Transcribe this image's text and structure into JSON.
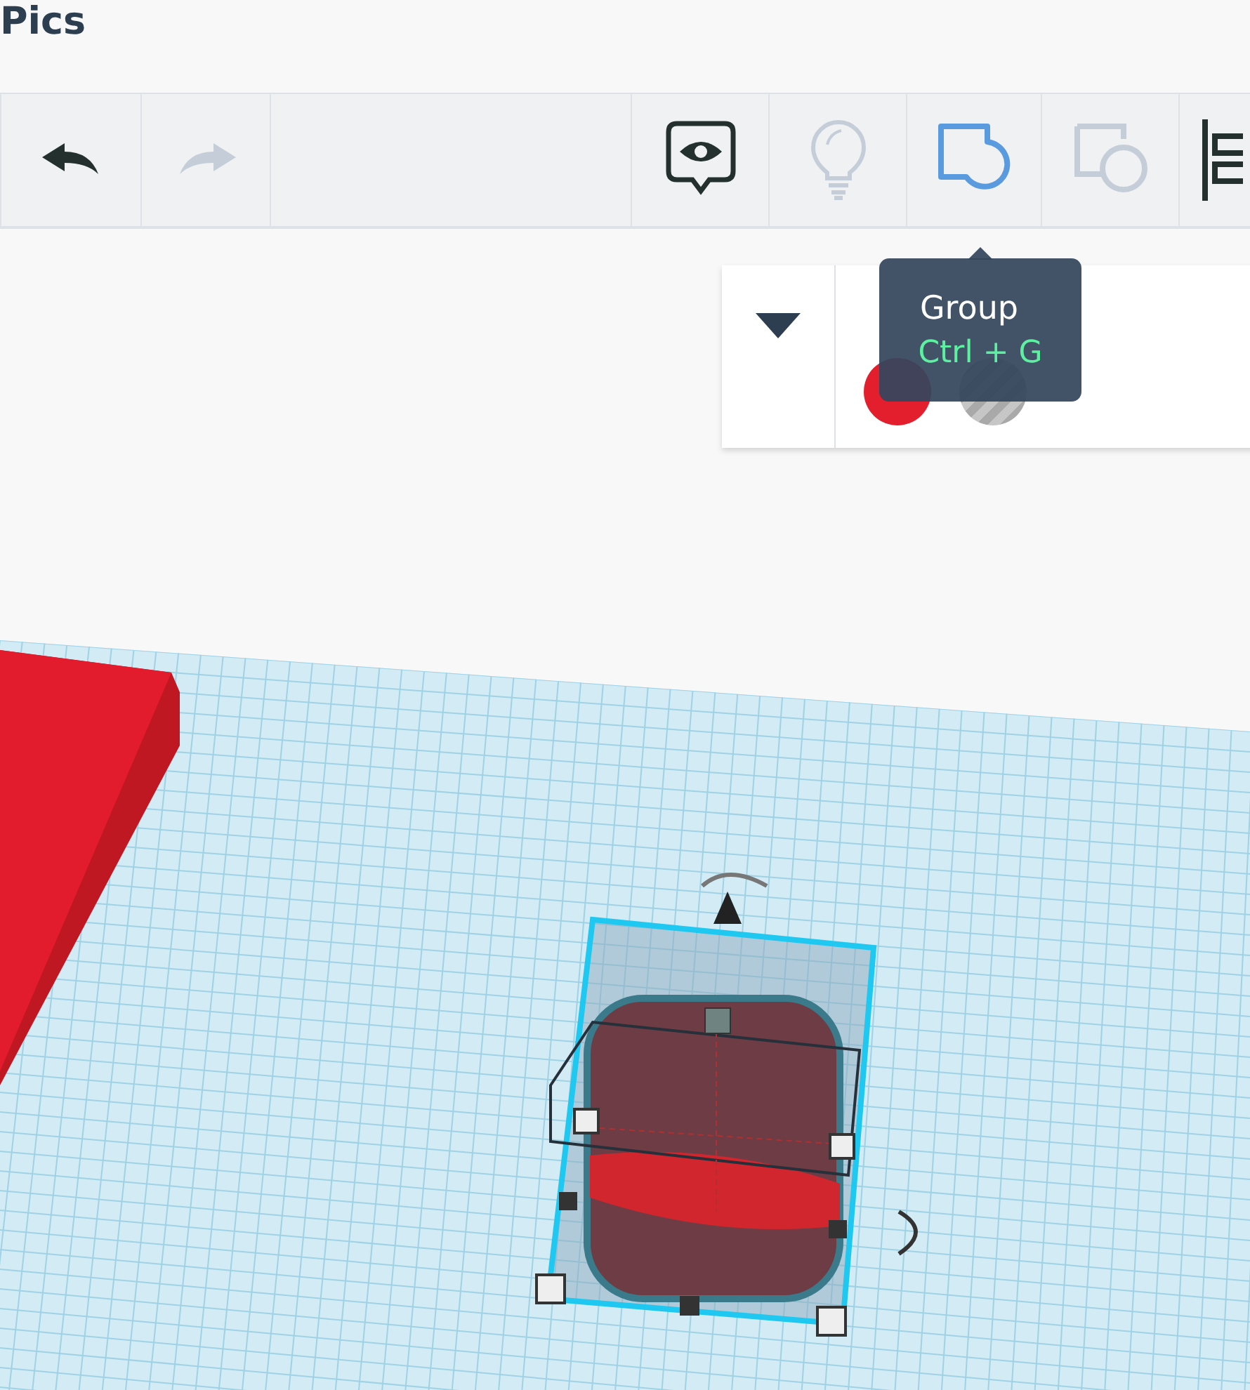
{
  "header": {
    "title": "Pics"
  },
  "toolbar": {
    "buttons": [
      {
        "kind": "undo",
        "disabled": false,
        "hovered": false
      },
      {
        "kind": "redo",
        "disabled": true
      },
      {
        "kind": "spacer"
      },
      {
        "kind": "notes",
        "disabled": false,
        "hovered": false
      },
      {
        "kind": "bulb",
        "disabled": true
      },
      {
        "kind": "group",
        "disabled": false,
        "hovered": true
      },
      {
        "kind": "ungroup",
        "disabled": true
      },
      {
        "kind": "align",
        "disabled": false,
        "hovered": false
      }
    ]
  },
  "tooltip": {
    "title": "Group",
    "shortcut": "Ctrl + G"
  },
  "inspector": {
    "expanded": true,
    "swatches": [
      {
        "kind": "solid",
        "color": "#e41f2d"
      },
      {
        "kind": "hole"
      }
    ]
  }
}
